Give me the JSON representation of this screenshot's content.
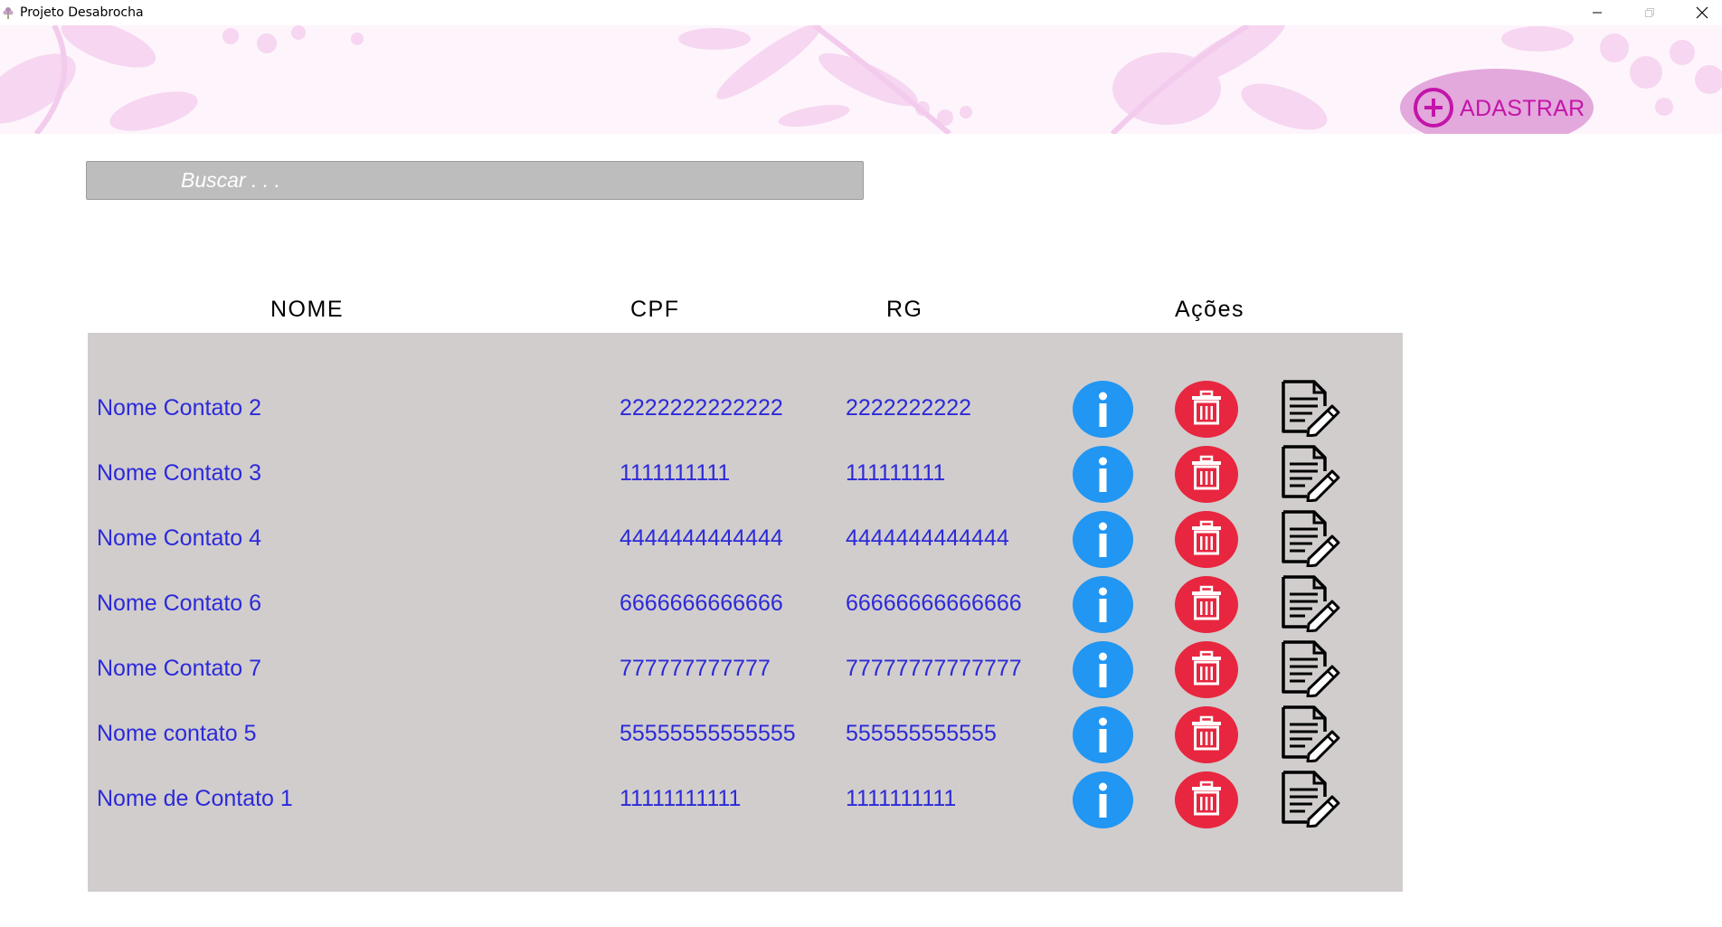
{
  "window": {
    "title": "Projeto Desabrocha"
  },
  "header": {
    "cadastrar_label": "ADASTRAR"
  },
  "search": {
    "placeholder": "Buscar . . ."
  },
  "table": {
    "columns": [
      "NOME",
      "CPF",
      "RG",
      "Ações"
    ],
    "rows": [
      {
        "nome": "Nome Contato 2",
        "cpf": "2222222222222",
        "rg": "2222222222"
      },
      {
        "nome": "Nome Contato 3",
        "cpf": "1111111111",
        "rg": "111111111"
      },
      {
        "nome": "Nome Contato 4",
        "cpf": "4444444444444",
        "rg": "4444444444444"
      },
      {
        "nome": "Nome Contato 6",
        "cpf": "6666666666666",
        "rg": "66666666666666"
      },
      {
        "nome": "Nome Contato 7",
        "cpf": "777777777777",
        "rg": "77777777777777"
      },
      {
        "nome": "Nome contato 5",
        "cpf": "55555555555555",
        "rg": "555555555555"
      },
      {
        "nome": "Nome de Contato 1",
        "cpf": "11111111111",
        "rg": "1111111111"
      }
    ]
  },
  "icons": {
    "info": "info-icon",
    "delete": "trash-icon",
    "edit": "edit-document-icon",
    "add": "plus-circle-icon"
  },
  "colors": {
    "banner_bg": "#fdf5fb",
    "cadastrar_bg": "#e3a8dc",
    "cadastrar_text": "#c414a9",
    "table_bg": "#d1cdcd",
    "row_text": "#2c2ad8",
    "info": "#2196f3",
    "delete": "#e8263f"
  }
}
